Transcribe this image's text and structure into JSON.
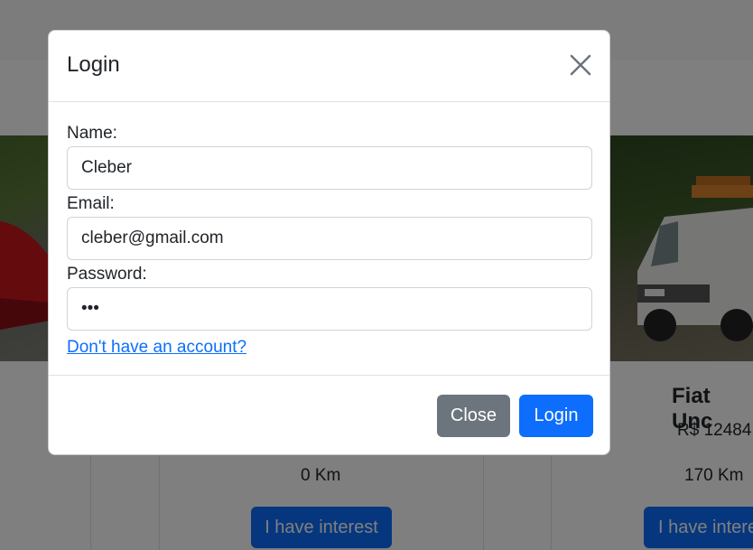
{
  "cards": [
    {
      "km": "0 Km",
      "interest_label": "I have interest"
    },
    {
      "title": "Fiat Unc",
      "price": "R$ 12484",
      "km": "170 Km",
      "interest_label": "I have intere"
    }
  ],
  "modal": {
    "title": "Login",
    "fields": {
      "name": {
        "label": "Name:",
        "value": "Cleber"
      },
      "email": {
        "label": "Email:",
        "value": "cleber@gmail.com"
      },
      "password": {
        "label": "Password:",
        "value": "abc"
      }
    },
    "signup_link": "Don't have an account?",
    "close_label": "Close",
    "login_label": "Login"
  },
  "colors": {
    "primary": "#0d6efd",
    "secondary": "#6c757d",
    "backdrop": "rgba(0,0,0,0.5)"
  }
}
